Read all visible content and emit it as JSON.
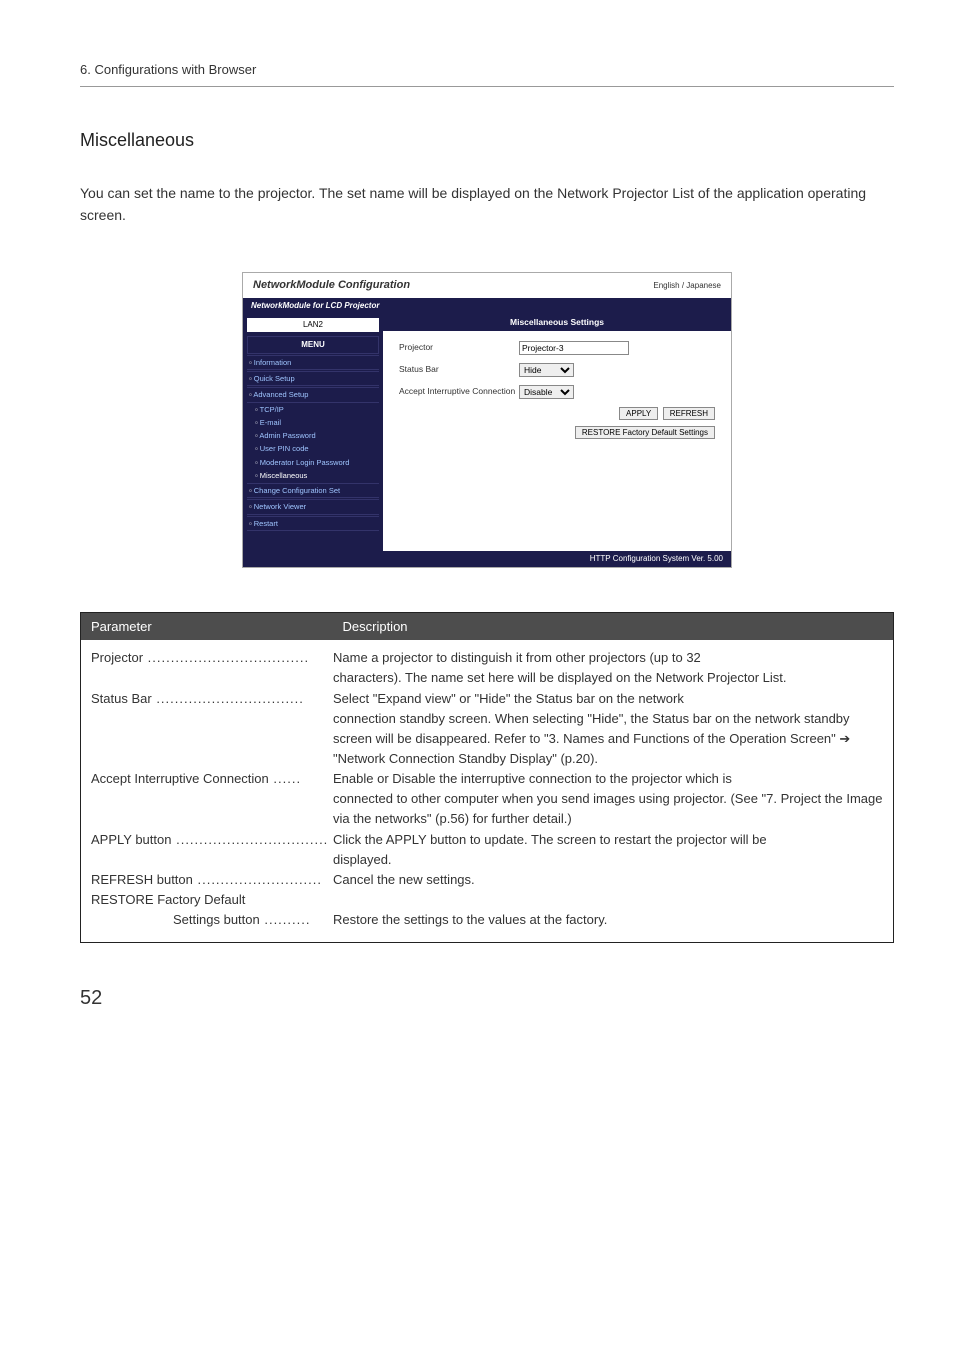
{
  "header": {
    "breadcrumb": "6. Configurations with Browser"
  },
  "title": "Miscellaneous",
  "intro": "You can set the name to the projector. The set name will be displayed on the Network Projector List of the application operating screen.",
  "screenshot": {
    "app_title": "NetworkModule Configuration",
    "lang_label": "English / Japanese",
    "sub_title": "NetworkModule for LCD Projector",
    "lan_label": "LAN2",
    "menu_label": "MENU",
    "nav": {
      "information": "Information",
      "quick_setup": "Quick Setup",
      "advanced_setup": "Advanced Setup",
      "tcpip": "TCP/IP",
      "email": "E-mail",
      "admin_pwd": "Admin Password",
      "user_pin": "User PIN code",
      "mod_login": "Moderator Login Password",
      "misc": "Miscellaneous",
      "change_config": "Change Configuration Set",
      "net_viewer": "Network Viewer",
      "restart": "Restart"
    },
    "panel_title": "Miscellaneous Settings",
    "form": {
      "projector_label": "Projector",
      "projector_value": "Projector-3",
      "status_label": "Status Bar",
      "status_value": "Hide",
      "accept_label": "Accept Interruptive Connection",
      "accept_value": "Disable"
    },
    "buttons": {
      "apply": "APPLY",
      "refresh": "REFRESH",
      "restore": "RESTORE Factory Default Settings"
    },
    "footer_version": "HTTP Configuration System Ver. 5.00"
  },
  "table": {
    "hdr_param": "Parameter",
    "hdr_desc": "Description",
    "rows": {
      "projector": {
        "label": "Projector",
        "desc1": "Name a projector to distinguish it from other projectors (up to 32",
        "desc2": "characters). The name set here will be displayed on the Network Projector List."
      },
      "status_bar": {
        "label": "Status Bar",
        "desc1": "Select \"Expand view\" or \"Hide\" the Status bar on the network",
        "desc2": "connection standby screen. When selecting \"Hide\", the Status bar on the network standby screen will be disappeared. Refer to \"3. Names and Functions of the Operation Screen\" ➔ \"Network Connection Standby Display\" (p.20)."
      },
      "accept": {
        "label": "Accept Interruptive Connection",
        "desc1": "Enable or Disable the interruptive connection to the projector which is",
        "desc2": "connected to other computer when you send images using projector. (See \"7. Project the Image via the networks\" (p.56) for further detail.)"
      },
      "apply_btn": {
        "label": "APPLY button",
        "desc1": "Click the APPLY button to update. The screen to restart the projector will be",
        "desc2": "displayed."
      },
      "refresh_btn": {
        "label": "REFRESH button",
        "desc1": "Cancel the new settings."
      },
      "restore": {
        "label": "RESTORE Factory Default",
        "sub_label": "Settings button",
        "desc1": "Restore the settings to the values at the factory."
      }
    }
  },
  "page_number": "52"
}
